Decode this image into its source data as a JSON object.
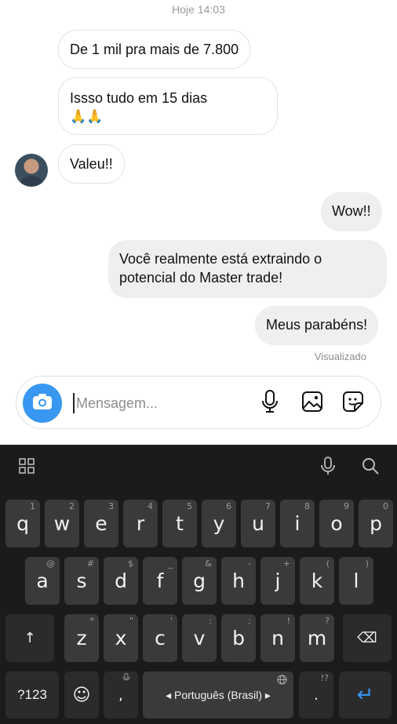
{
  "chat": {
    "timestamp": "Hoje 14:03",
    "messages": [
      {
        "text": "De 1 mil pra mais de 7.800"
      },
      {
        "text": "Issso tudo em 15 dias 🙏🙏",
        "text2": "🙏🙏"
      },
      {
        "text": "Valeu!!"
      },
      {
        "text": "Wow!!"
      },
      {
        "line1": "Você realmente está extraindo o",
        "line2": "potencial do Master trade!"
      },
      {
        "text": "Meus parabéns!"
      }
    ],
    "seen_label": "Visualizado"
  },
  "composer": {
    "placeholder": "Mensagem...",
    "icons": [
      "camera-icon",
      "microphone-icon",
      "image-icon",
      "sticker-icon"
    ],
    "accent": "#3897f0"
  },
  "keyboard": {
    "row1": [
      {
        "k": "q",
        "h": "1"
      },
      {
        "k": "w",
        "h": "2"
      },
      {
        "k": "e",
        "h": "3"
      },
      {
        "k": "r",
        "h": "4"
      },
      {
        "k": "t",
        "h": "5"
      },
      {
        "k": "y",
        "h": "6"
      },
      {
        "k": "u",
        "h": "7"
      },
      {
        "k": "i",
        "h": "8"
      },
      {
        "k": "o",
        "h": "9"
      },
      {
        "k": "p",
        "h": "0"
      }
    ],
    "row2": [
      {
        "k": "a",
        "h": "@"
      },
      {
        "k": "s",
        "h": "#"
      },
      {
        "k": "d",
        "h": "$"
      },
      {
        "k": "f",
        "h": "_"
      },
      {
        "k": "g",
        "h": "&"
      },
      {
        "k": "h",
        "h": "-"
      },
      {
        "k": "j",
        "h": "+"
      },
      {
        "k": "k",
        "h": "("
      },
      {
        "k": "l",
        "h": ")"
      }
    ],
    "row3": [
      {
        "k": "z",
        "h": "*"
      },
      {
        "k": "x",
        "h": "\""
      },
      {
        "k": "c",
        "h": "'"
      },
      {
        "k": "v",
        "h": ":"
      },
      {
        "k": "b",
        "h": ";"
      },
      {
        "k": "n",
        "h": "!"
      },
      {
        "k": "m",
        "h": "?"
      }
    ],
    "symbols_label": "?123",
    "comma": ",",
    "period": ".",
    "period_hint": "!?",
    "space_label": "◂ Português (Brasil) ▸",
    "shift_glyph": "↑",
    "backspace_glyph": "⌫",
    "enter_glyph": "↵",
    "emoji_glyph": "☺",
    "colors": {
      "background": "#1b1b1b",
      "key": "#3a3a3a",
      "enter": "#3897f0"
    }
  }
}
